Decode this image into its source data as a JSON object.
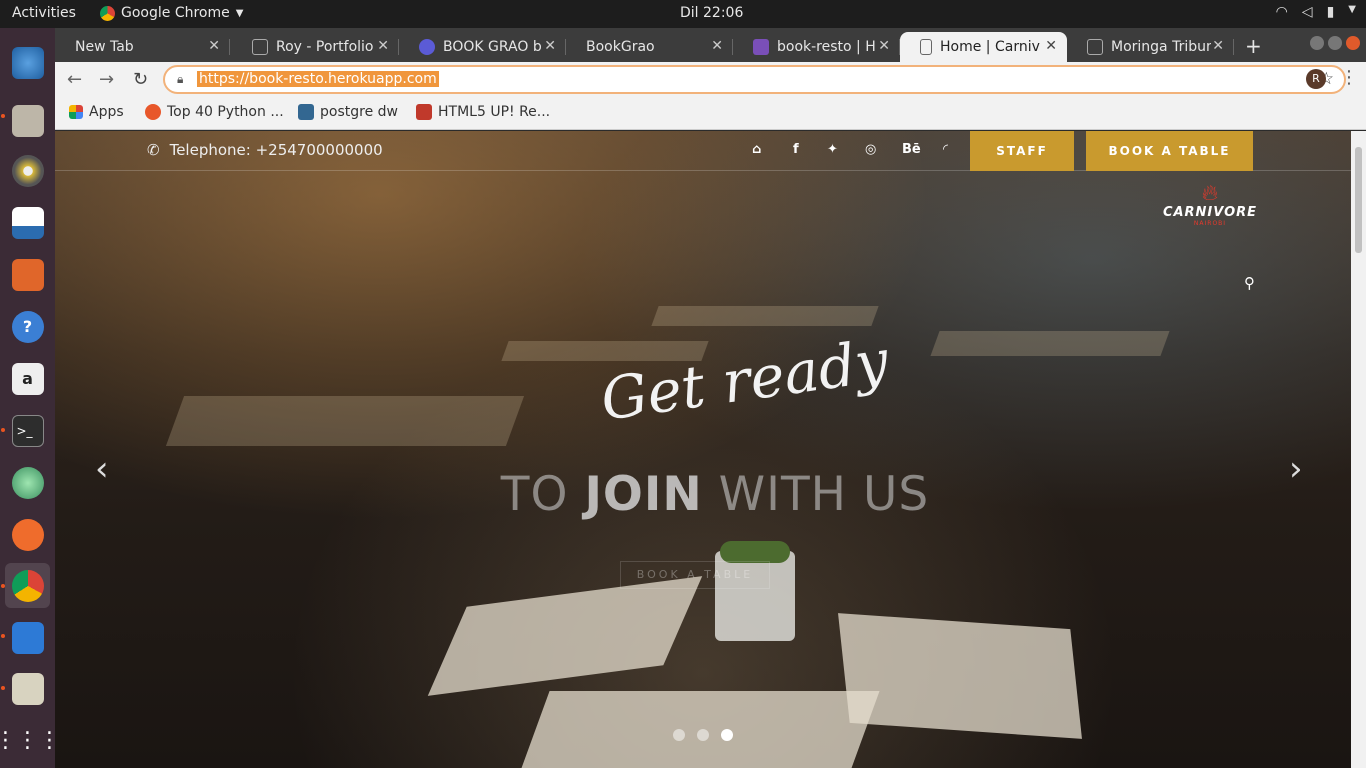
{
  "system": {
    "activities": "Activities",
    "app_name": "Google Chrome",
    "clock": "Dil 22:06"
  },
  "tabs": [
    {
      "title": "New Tab"
    },
    {
      "title": "Roy - Portfolio"
    },
    {
      "title": "BOOK GRAO by"
    },
    {
      "title": "BookGrao"
    },
    {
      "title": "book-resto | He"
    },
    {
      "title": "Home | Carnivo"
    },
    {
      "title": "Moringa Tribun"
    }
  ],
  "toolbar": {
    "url": "https://book-resto.herokuapp.com",
    "profile_initial": "R"
  },
  "bookmarks": [
    {
      "label": "Apps"
    },
    {
      "label": "Top 40 Python ..."
    },
    {
      "label": "postgre dw"
    },
    {
      "label": "HTML5 UP! Re..."
    }
  ],
  "site": {
    "telephone": "Telephone: +254700000000",
    "social_behance": "Bē",
    "staff_button": "STAFF",
    "book_button": "BOOK A TABLE",
    "logo_name": "CARNIVORE",
    "logo_sub": "NAIROBI",
    "hero_script": "Get ready",
    "hero_headline_pre": "TO ",
    "hero_headline_bold": "JOIN",
    "hero_headline_post": " WITH US",
    "hero_button": "BOOK A TABLE"
  },
  "colors": {
    "accent": "#c99a2e",
    "ubuntu_orange": "#e95420"
  }
}
